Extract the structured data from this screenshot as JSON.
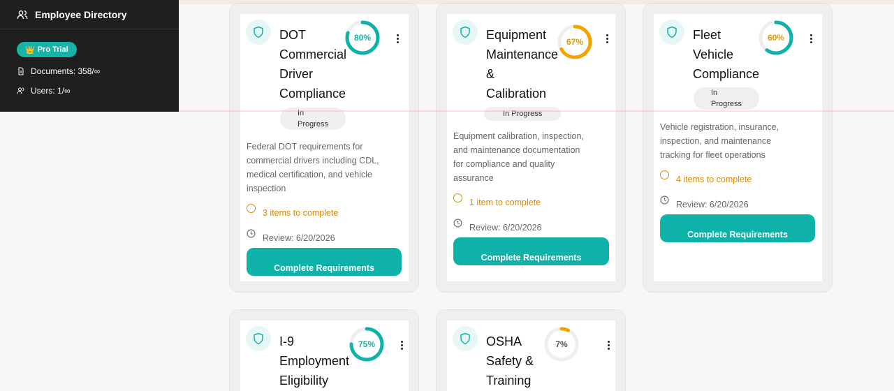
{
  "sidebar": {
    "title": "Employee Directory",
    "badge": "Pro Trial",
    "documents": "Documents: 358/∞",
    "users": "Users: 1/∞"
  },
  "colors": {
    "accent": "#0fb2a8",
    "warning": "#d98a00",
    "progress_amber": "#f0a500"
  },
  "cards": [
    {
      "title_lines": [
        "DOT",
        "Commercial",
        "Driver",
        "Compliance"
      ],
      "progress": "80%",
      "progress_value": 0.8,
      "status_lines": [
        "In",
        "Progress"
      ],
      "description": [
        "Federal DOT requirements for",
        "commercial drivers including CDL,",
        "medical certification, and vehicle",
        "inspection"
      ],
      "todo": "3 items to complete",
      "review": "Review: 6/20/2026",
      "cta": "Complete Requirements"
    },
    {
      "title_lines": [
        "Equipment",
        "Maintenance",
        "&",
        "Calibration"
      ],
      "progress": "67%",
      "progress_value": 0.67,
      "status_lines": [
        "In Progress"
      ],
      "description": [
        "Equipment calibration, inspection,",
        "and maintenance documentation",
        "for compliance and quality",
        "assurance"
      ],
      "todo": "1 item to complete",
      "review": "Review: 6/20/2026",
      "cta": "Complete Requirements"
    },
    {
      "title_lines": [
        "Fleet",
        "Vehicle",
        "Compliance"
      ],
      "progress": "60%",
      "progress_value": 0.6,
      "status_lines": [
        "In",
        "Progress"
      ],
      "description": [
        "Vehicle registration, insurance,",
        "inspection, and maintenance",
        "tracking for fleet operations"
      ],
      "todo": "4 items to complete",
      "review": "Review: 6/20/2026",
      "cta": "Complete Requirements"
    },
    {
      "title_lines": [
        "I-9",
        "Employment",
        "Eligibility"
      ],
      "progress": "75%",
      "progress_value": 0.75
    },
    {
      "title_lines": [
        "OSHA",
        "Safety &",
        "Training"
      ],
      "progress": "7%",
      "progress_value": 0.07
    }
  ]
}
